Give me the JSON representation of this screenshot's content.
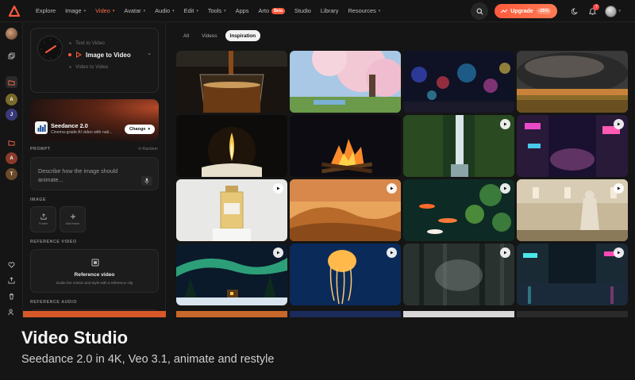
{
  "nav": {
    "items": [
      {
        "label": "Explore",
        "caret": false,
        "active": false
      },
      {
        "label": "Image",
        "caret": true,
        "active": false
      },
      {
        "label": "Video",
        "caret": true,
        "active": true
      },
      {
        "label": "Avatar",
        "caret": true,
        "active": false
      },
      {
        "label": "Audio",
        "caret": true,
        "active": false
      },
      {
        "label": "Edit",
        "caret": true,
        "active": false
      },
      {
        "label": "Tools",
        "caret": true,
        "active": false
      },
      {
        "label": "Apps",
        "caret": false,
        "active": false
      },
      {
        "label": "Arto",
        "caret": false,
        "active": false,
        "badge": "Beta"
      },
      {
        "label": "Studio",
        "caret": false,
        "active": false
      },
      {
        "label": "Library",
        "caret": false,
        "active": false
      },
      {
        "label": "Resources",
        "caret": true,
        "active": false
      }
    ],
    "upgrade_label": "Upgrade",
    "upgrade_discount": "-25%",
    "notification_count": "7",
    "accent": "#ff5a3c"
  },
  "rail": {
    "letters": [
      "A",
      "J",
      "A",
      "T"
    ]
  },
  "panel": {
    "modes": [
      "Text to Video",
      "Image to Video",
      "Video to Video"
    ],
    "active_mode": "Image to Video",
    "model": {
      "name": "Seedance 2.0",
      "description": "Cinema-grade AI video with nati...",
      "change_label": "Change"
    },
    "prompt_label": "PROMPT",
    "random_label": "⟲ Random",
    "prompt_placeholder": "Describe how the image should animate...",
    "image_label": "IMAGE",
    "image_slots": [
      "Frame",
      "Add frame"
    ],
    "reference_video_label": "REFERENCE VIDEO",
    "reference_video_title": "Reference video",
    "reference_video_desc": "Guide the motion and style with a reference clip",
    "reference_audio_label": "REFERENCE AUDIO"
  },
  "main": {
    "tabs": [
      {
        "label": "All",
        "active": false
      },
      {
        "label": "Videos",
        "active": false
      },
      {
        "label": "Inspiration",
        "active": true
      }
    ],
    "tiles": [
      {
        "name": "coffee-pour",
        "play": false
      },
      {
        "name": "cherry-blossom-tree",
        "play": false
      },
      {
        "name": "rainy-window-lights",
        "play": false
      },
      {
        "name": "storm-cloud-field",
        "play": false
      },
      {
        "name": "candle-flame",
        "play": false
      },
      {
        "name": "campfire-night",
        "play": false
      },
      {
        "name": "jungle-waterfall",
        "play": true
      },
      {
        "name": "neon-alley",
        "play": true
      },
      {
        "name": "perfume-bottle",
        "play": true
      },
      {
        "name": "desert-dunes",
        "play": true
      },
      {
        "name": "koi-pond",
        "play": true
      },
      {
        "name": "marble-statue-hall",
        "play": true
      },
      {
        "name": "aurora-cabin",
        "play": true
      },
      {
        "name": "glowing-jellyfish",
        "play": true
      },
      {
        "name": "misty-forest",
        "play": true
      },
      {
        "name": "neon-city-rain",
        "play": true
      }
    ]
  },
  "caption": {
    "title": "Video Studio",
    "subtitle": "Seedance 2.0 in 4K, Veo 3.1, animate and restyle"
  }
}
